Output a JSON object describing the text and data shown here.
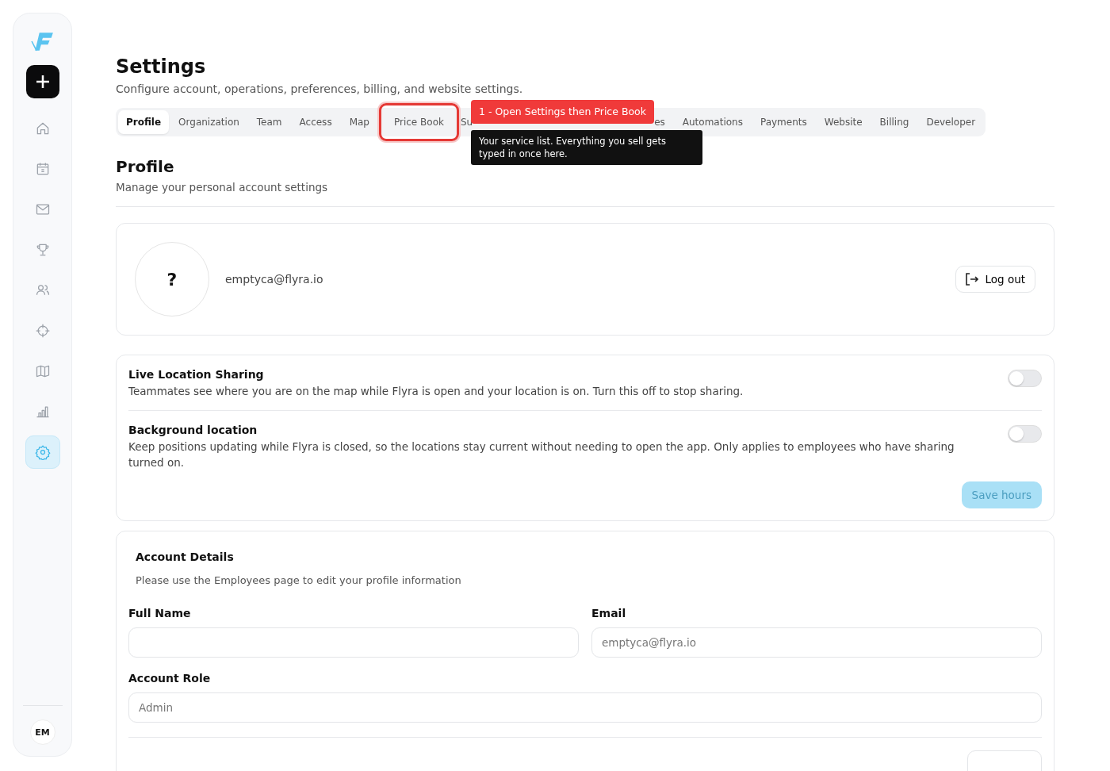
{
  "sidebar": {
    "items": [
      {
        "selected": false
      },
      {
        "selected": false
      },
      {
        "selected": false
      },
      {
        "selected": false
      },
      {
        "selected": false
      },
      {
        "selected": false
      },
      {
        "selected": false
      },
      {
        "selected": false
      },
      {
        "selected": true
      }
    ],
    "avatar": "EM"
  },
  "header": {
    "title": "Settings",
    "subtitle": "Configure account, operations, preferences, billing, and website settings."
  },
  "tabs": [
    {
      "label": "Profile",
      "selected": true,
      "highlighted": false
    },
    {
      "label": "Organization",
      "selected": false,
      "highlighted": false
    },
    {
      "label": "Team",
      "selected": false,
      "highlighted": false
    },
    {
      "label": "Access",
      "selected": false,
      "highlighted": false
    },
    {
      "label": "Map",
      "selected": false,
      "highlighted": false
    },
    {
      "label": "Price Book",
      "selected": false,
      "highlighted": true
    },
    {
      "label": "Su",
      "selected": false,
      "highlighted": false
    },
    {
      "label": "es",
      "selected": false,
      "highlighted": false
    },
    {
      "label": "Automations",
      "selected": false,
      "highlighted": false
    },
    {
      "label": "Payments",
      "selected": false,
      "highlighted": false
    },
    {
      "label": "Website",
      "selected": false,
      "highlighted": false
    },
    {
      "label": "Billing",
      "selected": false,
      "highlighted": false
    },
    {
      "label": "Developer",
      "selected": false,
      "highlighted": false
    }
  ],
  "callout": {
    "step": "1 - Open Settings then Price Book",
    "tooltip": "Your service list. Everything you sell gets typed in once here."
  },
  "section": {
    "title": "Profile",
    "subtitle": "Manage your personal account settings"
  },
  "profile_card": {
    "avatar": "?",
    "email": "emptyca@flyra.io",
    "logout": "Log out"
  },
  "location_settings": [
    {
      "title": "Live Location Sharing",
      "description": "Teammates see where you are on the map while Flyra is open and your location is on. Turn this off to stop sharing.",
      "on": false
    },
    {
      "title": "Background location",
      "description": "Keep positions updating while Flyra is closed, so the locations stay current without needing to open the app. Only applies to employees who have sharing turned on.",
      "on": false
    }
  ],
  "save_button": {
    "label": "Save hours",
    "disabled": true
  },
  "account_details": {
    "title": "Account Details",
    "note": "Please use the Employees page to edit your profile information",
    "fields": [
      {
        "label": "Full Name"
      },
      {
        "label": "Email",
        "value": "emptyca@flyra.io"
      },
      {
        "label": "Account Role",
        "value": "Admin"
      }
    ]
  }
}
